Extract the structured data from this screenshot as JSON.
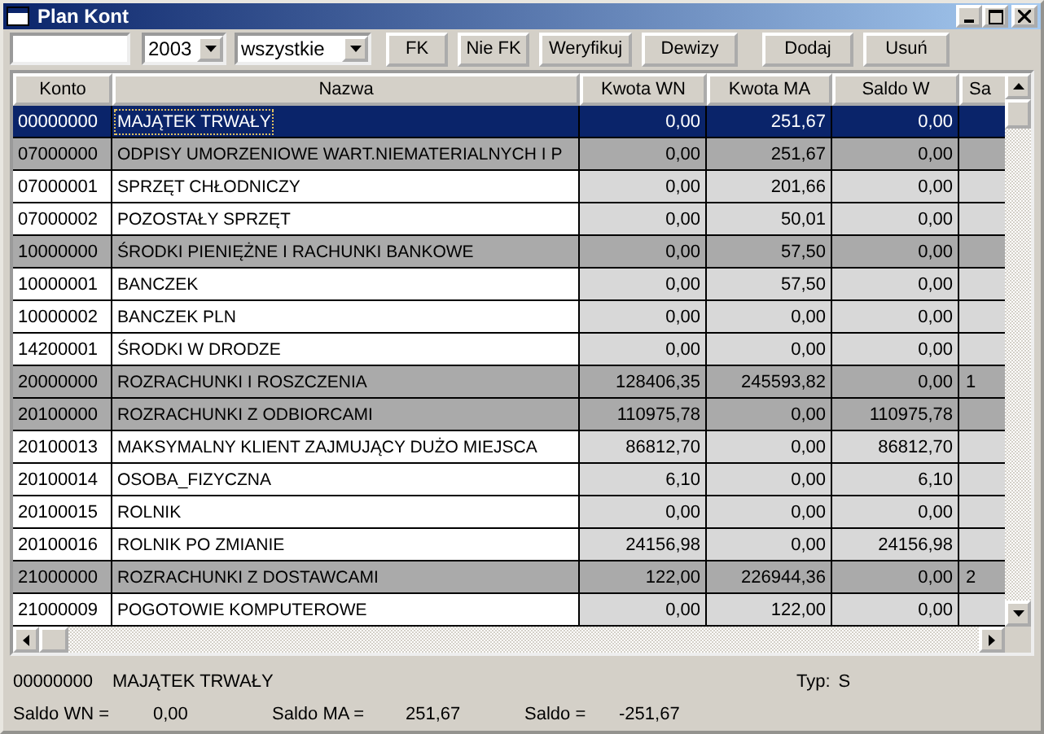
{
  "window": {
    "title": "Plan Kont"
  },
  "toolbar": {
    "year": "2003",
    "filter": "wszystkie",
    "buttons": [
      "FK",
      "Nie FK",
      "Weryfikuj",
      "Dewizy",
      "Dodaj",
      "Usuń"
    ]
  },
  "table": {
    "columns": [
      "Konto",
      "Nazwa",
      "Kwota WN",
      "Kwota MA",
      "Saldo W",
      "Sa"
    ],
    "rows": [
      {
        "kind": "group",
        "selected": true,
        "konto": "00000000",
        "nazwa": "MAJĄTEK TRWAŁY",
        "kwota_wn": "0,00",
        "kwota_ma": "251,67",
        "saldo_w": "0,00"
      },
      {
        "kind": "group",
        "selected": false,
        "konto": "07000000",
        "nazwa": "ODPISY UMORZENIOWE WART.NIEMATERIALNYCH I P",
        "kwota_wn": "0,00",
        "kwota_ma": "251,67",
        "saldo_w": "0,00"
      },
      {
        "kind": "account",
        "selected": false,
        "konto": "07000001",
        "nazwa": "SPRZĘT CHŁODNICZY",
        "kwota_wn": "0,00",
        "kwota_ma": "201,66",
        "saldo_w": "0,00"
      },
      {
        "kind": "account",
        "selected": false,
        "konto": "07000002",
        "nazwa": "POZOSTAŁY SPRZĘT",
        "kwota_wn": "0,00",
        "kwota_ma": "50,01",
        "saldo_w": "0,00"
      },
      {
        "kind": "group",
        "selected": false,
        "konto": "10000000",
        "nazwa": "ŚRODKI PIENIĘŻNE I RACHUNKI BANKOWE",
        "kwota_wn": "0,00",
        "kwota_ma": "57,50",
        "saldo_w": "0,00"
      },
      {
        "kind": "account",
        "selected": false,
        "konto": "10000001",
        "nazwa": "BANCZEK",
        "kwota_wn": "0,00",
        "kwota_ma": "57,50",
        "saldo_w": "0,00"
      },
      {
        "kind": "account",
        "selected": false,
        "konto": "10000002",
        "nazwa": "BANCZEK PLN",
        "kwota_wn": "0,00",
        "kwota_ma": "0,00",
        "saldo_w": "0,00"
      },
      {
        "kind": "account",
        "selected": false,
        "konto": "14200001",
        "nazwa": "ŚRODKI W DRODZE",
        "kwota_wn": "0,00",
        "kwota_ma": "0,00",
        "saldo_w": "0,00"
      },
      {
        "kind": "group",
        "selected": false,
        "konto": "20000000",
        "nazwa": "ROZRACHUNKI I ROSZCZENIA",
        "kwota_wn": "128406,35",
        "kwota_ma": "245593,82",
        "saldo_w": "0,00",
        "column_5": "1"
      },
      {
        "kind": "group",
        "selected": false,
        "konto": "20100000",
        "nazwa": "ROZRACHUNKI Z ODBIORCAMI",
        "kwota_wn": "110975,78",
        "kwota_ma": "0,00",
        "saldo_w": "110975,78"
      },
      {
        "kind": "account",
        "selected": false,
        "konto": "20100013",
        "nazwa": "MAKSYMALNY KLIENT ZAJMUJĄCY DUŻO MIEJSCA",
        "kwota_wn": "86812,70",
        "kwota_ma": "0,00",
        "saldo_w": "86812,70"
      },
      {
        "kind": "account",
        "selected": false,
        "konto": "20100014",
        "nazwa": "OSOBA_FIZYCZNA",
        "kwota_wn": "6,10",
        "kwota_ma": "0,00",
        "saldo_w": "6,10"
      },
      {
        "kind": "account",
        "selected": false,
        "konto": "20100015",
        "nazwa": "ROLNIK",
        "kwota_wn": "0,00",
        "kwota_ma": "0,00",
        "saldo_w": "0,00"
      },
      {
        "kind": "account",
        "selected": false,
        "konto": "20100016",
        "nazwa": "ROLNIK PO ZMIANIE",
        "kwota_wn": "24156,98",
        "kwota_ma": "0,00",
        "saldo_w": "24156,98"
      },
      {
        "kind": "group",
        "selected": false,
        "konto": "21000000",
        "nazwa": "ROZRACHUNKI Z DOSTAWCAMI",
        "kwota_wn": "122,00",
        "kwota_ma": "226944,36",
        "saldo_w": "0,00",
        "column_5": "2"
      },
      {
        "kind": "account",
        "selected": false,
        "konto": "21000009",
        "nazwa": "POGOTOWIE KOMPUTEROWE",
        "kwota_wn": "0,00",
        "kwota_ma": "122,00",
        "saldo_w": "0,00"
      }
    ]
  },
  "details": {
    "konto": "00000000",
    "nazwa": "MAJĄTEK TRWAŁY",
    "typ_label": "Typ:",
    "typ": "S",
    "saldo_wn_label": "Saldo WN =",
    "saldo_wn": "0,00",
    "saldo_ma_label": "Saldo MA =",
    "saldo_ma": "251,67",
    "saldo_label": "Saldo =",
    "saldo": "-251,67"
  }
}
